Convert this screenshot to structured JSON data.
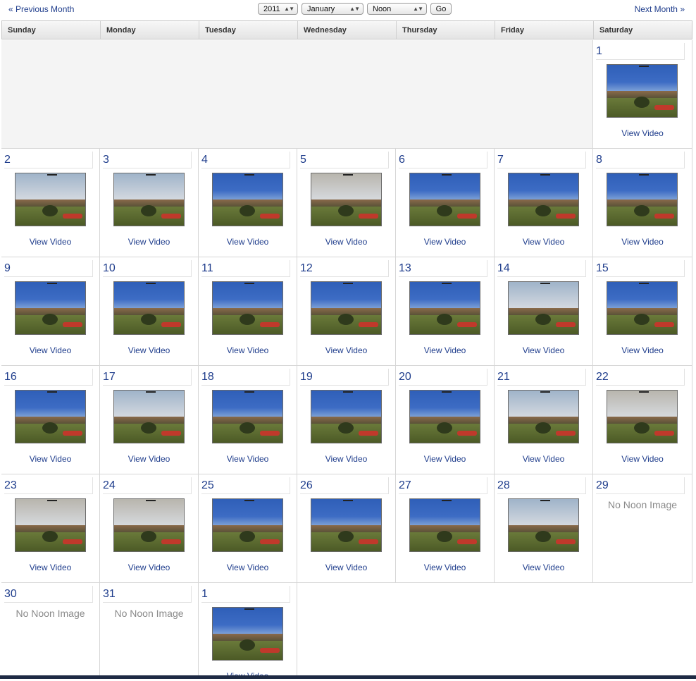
{
  "nav": {
    "prev_label": "« Previous Month",
    "next_label": "Next Month »",
    "year": "2011",
    "month": "January",
    "time": "Noon",
    "go_label": "Go"
  },
  "weekdays": [
    "Sunday",
    "Monday",
    "Tuesday",
    "Wednesday",
    "Thursday",
    "Friday",
    "Saturday"
  ],
  "view_label": "View Video",
  "no_image_label": "No Noon Image",
  "days": {
    "d1": "1",
    "d2": "2",
    "d3": "3",
    "d4": "4",
    "d5": "5",
    "d6": "6",
    "d7": "7",
    "d8": "8",
    "d9": "9",
    "d10": "10",
    "d11": "11",
    "d12": "12",
    "d13": "13",
    "d14": "14",
    "d15": "15",
    "d16": "16",
    "d17": "17",
    "d18": "18",
    "d19": "19",
    "d20": "20",
    "d21": "21",
    "d22": "22",
    "d23": "23",
    "d24": "24",
    "d25": "25",
    "d26": "26",
    "d27": "27",
    "d28": "28",
    "d29": "29",
    "d30": "30",
    "d31": "31",
    "next1": "1"
  },
  "colors": {
    "link": "#1f3d8c",
    "sky_clear": "#3d6cc4",
    "sky_cloudy": "#9fb3c9",
    "sky_overcast": "#b8b5ad",
    "no_image_text": "#8a8a8a"
  }
}
